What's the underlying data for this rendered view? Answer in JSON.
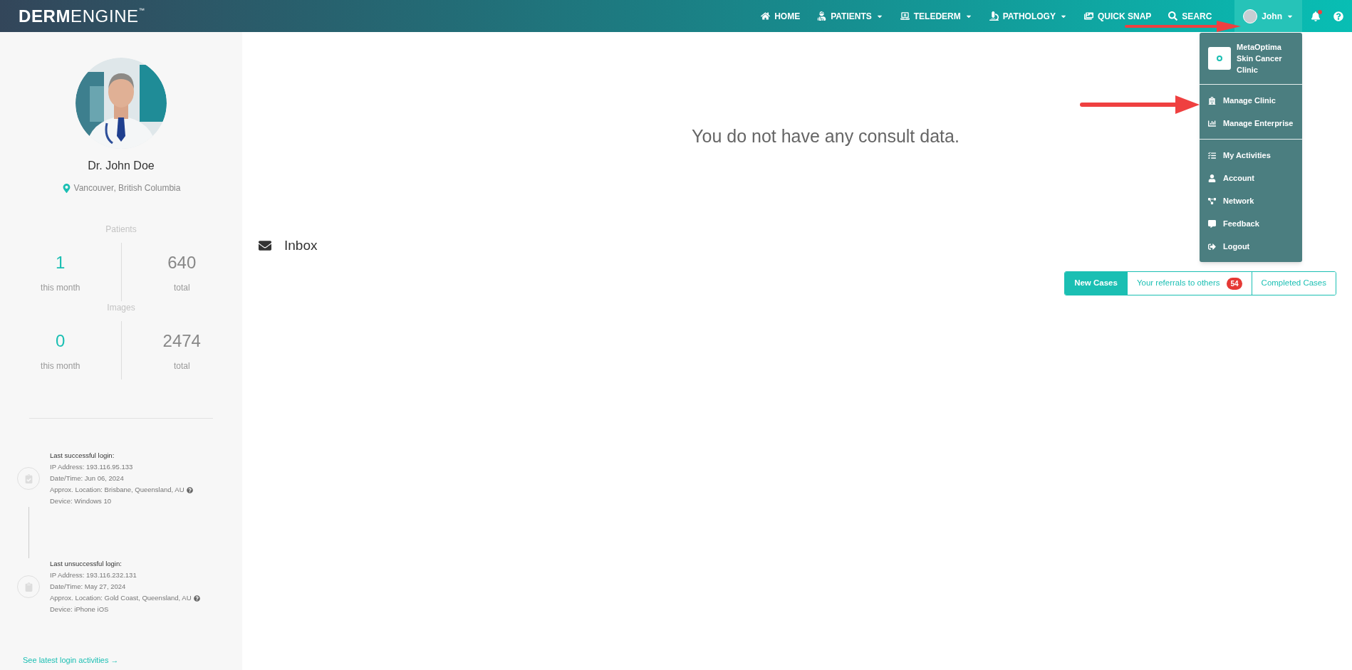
{
  "logo": {
    "bold": "DERM",
    "light": "ENGINE",
    "mark": "™"
  },
  "nav": {
    "items": [
      {
        "label": "HOME",
        "caret": false
      },
      {
        "label": "PATIENTS",
        "caret": true
      },
      {
        "label": "TELEDERM",
        "caret": true
      },
      {
        "label": "PATHOLOGY",
        "caret": true
      },
      {
        "label": "QUICK SNAP",
        "caret": false
      },
      {
        "label": "SEARC",
        "caret": false
      }
    ],
    "user": {
      "label": "John",
      "expanded": true
    }
  },
  "user_menu": {
    "clinic": "MetaOptima Skin Cancer Clinic",
    "groups": [
      [
        {
          "label": "Manage Clinic"
        },
        {
          "label": "Manage Enterprise"
        }
      ],
      [
        {
          "label": "My Activities"
        },
        {
          "label": "Account"
        },
        {
          "label": "Network"
        },
        {
          "label": "Feedback"
        },
        {
          "label": "Logout"
        }
      ]
    ]
  },
  "sidebar": {
    "name": "Dr. John Doe",
    "location": "Vancouver, British Columbia",
    "stats": [
      {
        "title": "Patients",
        "month": "1",
        "month_label": "this month",
        "total": "640",
        "total_label": "total"
      },
      {
        "title": "Images",
        "month": "0",
        "month_label": "this month",
        "total": "2474",
        "total_label": "total"
      }
    ],
    "logins": [
      {
        "kind": "success",
        "lines": [
          "Last successful login:",
          "IP Address: 193.116.95.133",
          "Date/Time: Jun 06, 2024",
          "Approx. Location: Brisbane, Queensland, AU",
          "Device: Windows 10"
        ]
      },
      {
        "kind": "failure",
        "lines": [
          "Last unsuccessful login:",
          "IP Address: 193.116.232.131",
          "Date/Time: May 27, 2024",
          "Approx. Location: Gold Coast, Queensland, AU",
          "Device: iPhone iOS"
        ]
      }
    ],
    "link": "See latest login activities →"
  },
  "main": {
    "empty_message": "You do not have any consult data.",
    "inbox_title": "Inbox",
    "tabs": [
      {
        "label": "New Cases",
        "selected": true
      },
      {
        "label": "Your referrals to others",
        "selected": false,
        "badge": "54"
      },
      {
        "label": "Completed Cases",
        "selected": false
      }
    ]
  }
}
